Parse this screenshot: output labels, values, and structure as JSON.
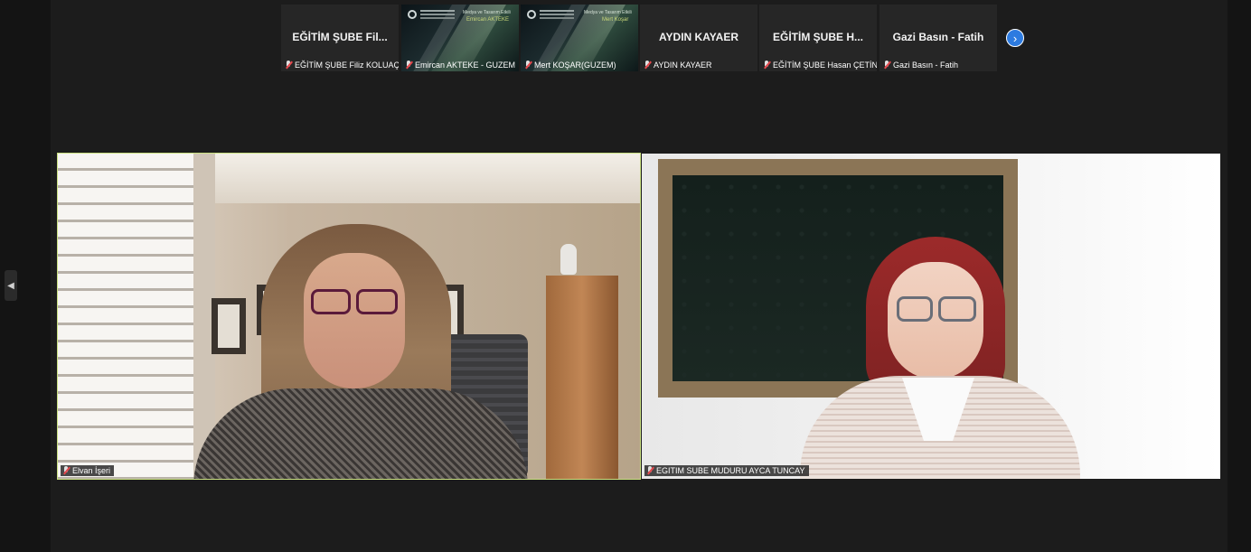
{
  "participants": [
    {
      "tile_title": "EĞİTİM ŞUBE Fil...",
      "label": "EĞİTİM ŞUBE Filiz KOLUAÇIK",
      "muted": true,
      "has_video": false
    },
    {
      "tile_title": "",
      "label": "Emircan AKTEKE - GUZEM",
      "muted": true,
      "has_video": true,
      "slide_line1": "Medya ve Tasarım Etkili",
      "slide_line2": "Emircan AKTEKE"
    },
    {
      "tile_title": "",
      "label": "Mert KOŞAR(GUZEM)",
      "muted": true,
      "has_video": true,
      "slide_line1": "Medya ve Tasarım Etkili",
      "slide_line2": "Mert Koşar"
    },
    {
      "tile_title": "AYDIN KAYAER",
      "label": "AYDIN KAYAER",
      "muted": true,
      "has_video": false
    },
    {
      "tile_title": "EĞİTİM ŞUBE H...",
      "label": "EĞİTİM ŞUBE Hasan ÇETİN",
      "muted": true,
      "has_video": false
    },
    {
      "tile_title": "Gazi Basın - Fatih",
      "label": "Gazi Basın - Fatih",
      "muted": true,
      "has_video": false
    }
  ],
  "strip_next_icon": "chevron-right-icon",
  "side_toggle_icon": "triangle-left-icon",
  "main_videos": [
    {
      "label": "Elvan İşeri",
      "active_speaker": true,
      "muted": true
    },
    {
      "label": "EGITIM SUBE MUDURU AYCA TUNCAY",
      "active_speaker": false,
      "muted": true
    }
  ],
  "colors": {
    "background": "#1c1c1c",
    "tile": "#262626",
    "active_speaker_border": "#c9e080",
    "accent_blue": "#2d7be0",
    "muted_red": "#e5484d"
  }
}
